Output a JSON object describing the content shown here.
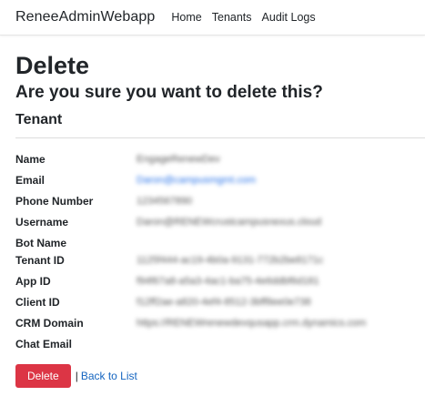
{
  "navbar": {
    "brand": "ReneeAdminWebapp",
    "links": [
      "Home",
      "Tenants",
      "Audit Logs"
    ]
  },
  "page": {
    "title": "Delete",
    "question": "Are you sure you want to delete this?",
    "entity": "Tenant"
  },
  "details": [
    {
      "label": "Name",
      "value": "EngageRenewDev"
    },
    {
      "label": "Email",
      "value": "Daron@campusmgmt.com"
    },
    {
      "label": "Phone Number",
      "value": "1234567890"
    },
    {
      "label": "Username",
      "value": "Daron@RENEWcrustcampusnexus.cloud"
    },
    {
      "label": "Bot Name",
      "value": ""
    },
    {
      "label": "Tenant ID",
      "value": "1125f444-ac19-4b0a-9131-772b2be8171c"
    },
    {
      "label": "App ID",
      "value": "f94f67a8-a5a3-4ac1-ba75-4e6ddbf6d181"
    },
    {
      "label": "Client ID",
      "value": "f12ff2ae-a820-4ef4-8512-3bff8ee0e738"
    },
    {
      "label": "CRM Domain",
      "value": "https://RENEWrenewdevqusapp.crm.dynamics.com"
    },
    {
      "label": "Chat Email",
      "value": ""
    }
  ],
  "actions": {
    "delete_label": "Delete",
    "separator": "|",
    "back_label": "Back to List"
  },
  "colors": {
    "danger": "#dc3545",
    "link": "#1565c0"
  }
}
